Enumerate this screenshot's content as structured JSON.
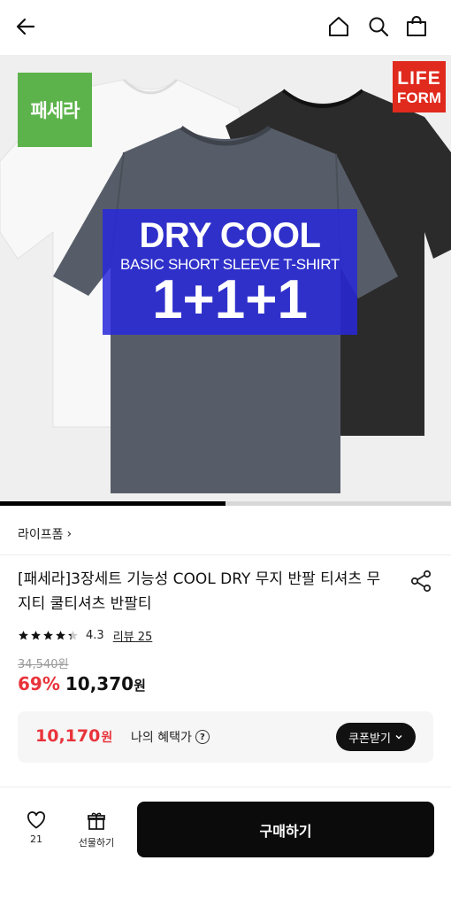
{
  "header": {
    "back_icon": "arrow-left-icon",
    "home_icon": "home-icon",
    "search_icon": "search-icon",
    "cart_icon": "shopping-bag-icon"
  },
  "hero": {
    "brand_logo_text": "패세라",
    "badge_line1": "LIFE",
    "badge_line2": "FORM",
    "promo_title": "DRY COOL",
    "promo_subtitle": "BASIC SHORT SLEEVE T-SHIRT",
    "promo_offer": "1+1+1",
    "image_progress": 0.5
  },
  "store": {
    "name": "라이프폼",
    "chevron": "›"
  },
  "product": {
    "title": "[패세라]3장세트 기능성 COOL DRY 무지 반팔 티셔츠 무지티 쿨티셔츠 반팔티",
    "rating": "4.3",
    "rating_value": 4.3,
    "review_label": "리뷰 25",
    "original_price": "34,540원",
    "discount": "69%",
    "sale_price": "10,370",
    "sale_unit": "원"
  },
  "benefit": {
    "price": "10,170",
    "price_unit": "원",
    "label": "나의 혜택가",
    "help_icon": "?",
    "coupon_label": "쿠폰받기",
    "coupon_chevron": "⌄"
  },
  "bottom_bar": {
    "wishlist_count": "21",
    "gift_label": "선물하기",
    "buy_label": "구매하기"
  },
  "colors": {
    "accent_red": "#e8343a",
    "promo_blue": "#2828dc",
    "brand_green": "#5db34b",
    "badge_red": "#e02a1e"
  }
}
